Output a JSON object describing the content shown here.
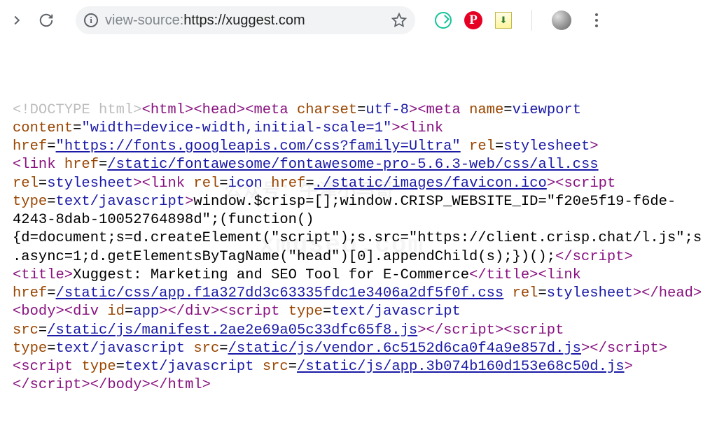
{
  "toolbar": {
    "url_prefix": "view-source:",
    "url_host": "https://xuggest.com",
    "info_glyph": "i"
  },
  "watermark": {
    "line1": "公众号：牛津小马哥",
    "line2": "xmgseo.com"
  },
  "source": {
    "tokens": [
      {
        "t": "doctype",
        "v": "<!DOCTYPE html>"
      },
      {
        "t": "tag",
        "v": "<html>"
      },
      {
        "t": "tag",
        "v": "<head>"
      },
      {
        "t": "open",
        "v": "<meta"
      },
      {
        "t": "sp",
        "v": " "
      },
      {
        "t": "attrname",
        "v": "charset"
      },
      {
        "t": "eq",
        "v": "="
      },
      {
        "t": "attrval",
        "v": "utf-8"
      },
      {
        "t": "tag",
        "v": ">"
      },
      {
        "t": "open",
        "v": "<meta"
      },
      {
        "t": "sp",
        "v": " "
      },
      {
        "t": "attrname",
        "v": "name"
      },
      {
        "t": "eq",
        "v": "="
      },
      {
        "t": "attrval",
        "v": "viewport"
      },
      {
        "t": "sp",
        "v": " "
      },
      {
        "t": "attrname",
        "v": "content"
      },
      {
        "t": "eq",
        "v": "="
      },
      {
        "t": "attrval",
        "v": "\"width=device-width,initial-scale=1\""
      },
      {
        "t": "tag",
        "v": ">"
      },
      {
        "t": "open",
        "v": "<link"
      },
      {
        "t": "sp",
        "v": " "
      },
      {
        "t": "attrname",
        "v": "href"
      },
      {
        "t": "eq",
        "v": "="
      },
      {
        "t": "link",
        "v": "\"https://fonts.googleapis.com/css?family=Ultra\""
      },
      {
        "t": "sp",
        "v": " "
      },
      {
        "t": "attrname",
        "v": "rel"
      },
      {
        "t": "eq",
        "v": "="
      },
      {
        "t": "attrval",
        "v": "stylesheet"
      },
      {
        "t": "tag",
        "v": ">"
      },
      {
        "t": "nl",
        "v": "\n"
      },
      {
        "t": "open",
        "v": "<link"
      },
      {
        "t": "sp",
        "v": " "
      },
      {
        "t": "attrname",
        "v": "href"
      },
      {
        "t": "eq",
        "v": "="
      },
      {
        "t": "link",
        "v": "/static/fontawesome/fontawesome-pro-5.6.3-web/css/all.css"
      },
      {
        "t": "sp",
        "v": " "
      },
      {
        "t": "attrname",
        "v": "rel"
      },
      {
        "t": "eq",
        "v": "="
      },
      {
        "t": "attrval",
        "v": "stylesheet"
      },
      {
        "t": "tag",
        "v": ">"
      },
      {
        "t": "open",
        "v": "<link"
      },
      {
        "t": "sp",
        "v": " "
      },
      {
        "t": "attrname",
        "v": "rel"
      },
      {
        "t": "eq",
        "v": "="
      },
      {
        "t": "attrval",
        "v": "icon"
      },
      {
        "t": "sp",
        "v": " "
      },
      {
        "t": "attrname",
        "v": "href"
      },
      {
        "t": "eq",
        "v": "="
      },
      {
        "t": "link",
        "v": "./static/images/favicon.ico"
      },
      {
        "t": "tag",
        "v": ">"
      },
      {
        "t": "open",
        "v": "<script"
      },
      {
        "t": "sp",
        "v": " "
      },
      {
        "t": "attrname",
        "v": "type"
      },
      {
        "t": "eq",
        "v": "="
      },
      {
        "t": "attrval",
        "v": "text/javascript"
      },
      {
        "t": "tag",
        "v": ">"
      },
      {
        "t": "text",
        "v": "window.$crisp=[];window.CRISP_WEBSITE_ID=\"f20e5f19-f6de-4243-8dab-10052764898d\";(function(){d=document;s=d.createElement(\"script\");s.src=\"https://client.crisp.chat/l.js\";s.async=1;d.getElementsByTagName(\"head\")[0].appendChild(s);})();"
      },
      {
        "t": "tag",
        "v": "</scr"
      },
      {
        "t": "tag",
        "v": "ipt>"
      },
      {
        "t": "tag",
        "v": "<title>"
      },
      {
        "t": "text",
        "v": "Xuggest: Marketing and SEO Tool for E-Commerce"
      },
      {
        "t": "tag",
        "v": "</title>"
      },
      {
        "t": "open",
        "v": "<link"
      },
      {
        "t": "sp",
        "v": " "
      },
      {
        "t": "attrname",
        "v": "href"
      },
      {
        "t": "eq",
        "v": "="
      },
      {
        "t": "link",
        "v": "/static/css/app.f1a327dd3c63335fdc1e3406a2df5f0f.css"
      },
      {
        "t": "sp",
        "v": " "
      },
      {
        "t": "attrname",
        "v": "rel"
      },
      {
        "t": "eq",
        "v": "="
      },
      {
        "t": "attrval",
        "v": "stylesheet"
      },
      {
        "t": "tag",
        "v": ">"
      },
      {
        "t": "tag",
        "v": "</head>"
      },
      {
        "t": "tag",
        "v": "<body>"
      },
      {
        "t": "open",
        "v": "<div"
      },
      {
        "t": "sp",
        "v": " "
      },
      {
        "t": "attrname",
        "v": "id"
      },
      {
        "t": "eq",
        "v": "="
      },
      {
        "t": "attrval",
        "v": "app"
      },
      {
        "t": "tag",
        "v": ">"
      },
      {
        "t": "tag",
        "v": "</div>"
      },
      {
        "t": "open",
        "v": "<script"
      },
      {
        "t": "sp",
        "v": " "
      },
      {
        "t": "attrname",
        "v": "type"
      },
      {
        "t": "eq",
        "v": "="
      },
      {
        "t": "attrval",
        "v": "text/javascript"
      },
      {
        "t": "sp",
        "v": " "
      },
      {
        "t": "attrname",
        "v": "src"
      },
      {
        "t": "eq",
        "v": "="
      },
      {
        "t": "link",
        "v": "/static/js/manifest.2ae2e69a05c33dfc65f8.js"
      },
      {
        "t": "tag",
        "v": ">"
      },
      {
        "t": "tag",
        "v": "</scr"
      },
      {
        "t": "tag",
        "v": "ipt>"
      },
      {
        "t": "open",
        "v": "<script"
      },
      {
        "t": "sp",
        "v": " "
      },
      {
        "t": "attrname",
        "v": "type"
      },
      {
        "t": "eq",
        "v": "="
      },
      {
        "t": "attrval",
        "v": "text/javascript"
      },
      {
        "t": "sp",
        "v": " "
      },
      {
        "t": "attrname",
        "v": "src"
      },
      {
        "t": "eq",
        "v": "="
      },
      {
        "t": "link",
        "v": "/static/js/vendor.6c5152d6ca0f4a9e857d.js"
      },
      {
        "t": "tag",
        "v": ">"
      },
      {
        "t": "tag",
        "v": "</scr"
      },
      {
        "t": "tag",
        "v": "ipt>"
      },
      {
        "t": "open",
        "v": "<script"
      },
      {
        "t": "sp",
        "v": " "
      },
      {
        "t": "attrname",
        "v": "type"
      },
      {
        "t": "eq",
        "v": "="
      },
      {
        "t": "attrval",
        "v": "text/javascript"
      },
      {
        "t": "sp",
        "v": " "
      },
      {
        "t": "attrname",
        "v": "src"
      },
      {
        "t": "eq",
        "v": "="
      },
      {
        "t": "link",
        "v": "/static/js/app.3b074b160d153e68c50d.js"
      },
      {
        "t": "tag",
        "v": ">"
      },
      {
        "t": "tag",
        "v": "</scr"
      },
      {
        "t": "tag",
        "v": "ipt>"
      },
      {
        "t": "tag",
        "v": "</body>"
      },
      {
        "t": "tag",
        "v": "</html>"
      }
    ]
  }
}
